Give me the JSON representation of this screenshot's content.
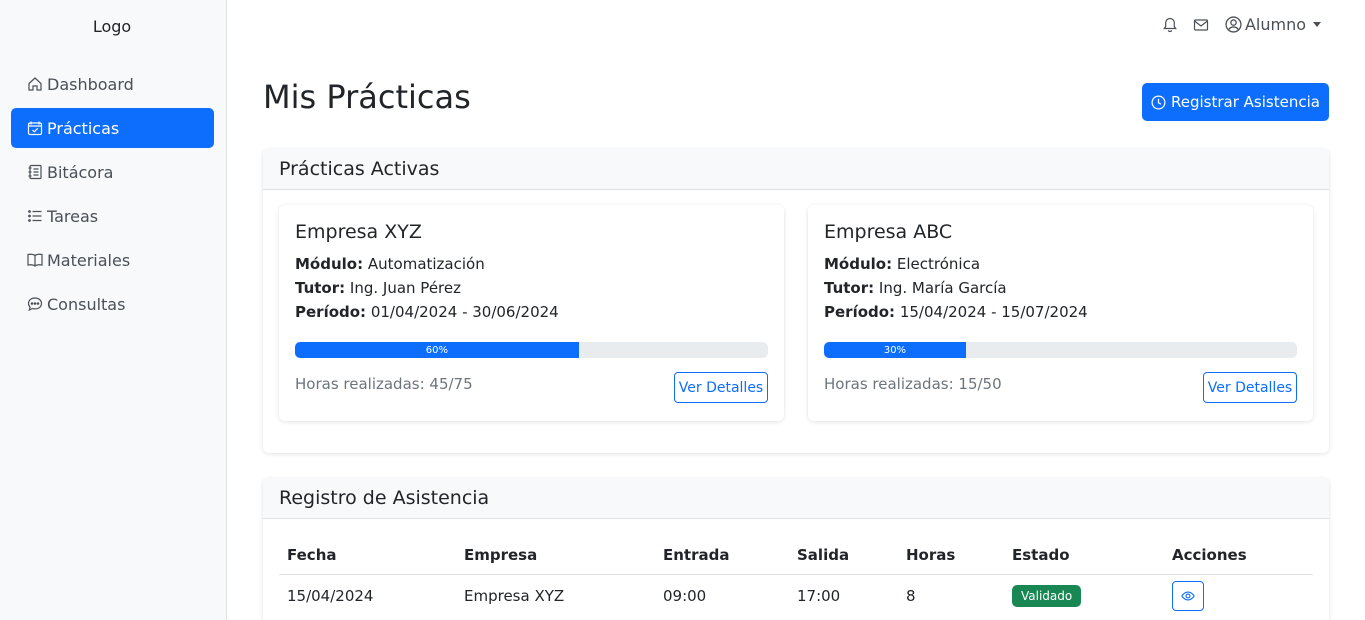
{
  "sidebar": {
    "logo": "Logo",
    "items": [
      {
        "label": "Dashboard",
        "icon": "home-icon"
      },
      {
        "label": "Prácticas",
        "icon": "calendar-check-icon",
        "active": true
      },
      {
        "label": "Bitácora",
        "icon": "journal-icon"
      },
      {
        "label": "Tareas",
        "icon": "list-task-icon"
      },
      {
        "label": "Materiales",
        "icon": "book-icon"
      },
      {
        "label": "Consultas",
        "icon": "chat-dots-icon"
      }
    ]
  },
  "topbar": {
    "user_label": "Alumno"
  },
  "page": {
    "title": "Mis Prácticas",
    "register_button": "Registrar Asistencia"
  },
  "active_practices": {
    "header": "Prácticas Activas",
    "modulo_label": "Módulo:",
    "tutor_label": "Tutor:",
    "periodo_label": "Período:",
    "details_button": "Ver Detalles",
    "items": [
      {
        "company": "Empresa XYZ",
        "modulo": "Automatización",
        "tutor": "Ing. Juan Pérez",
        "periodo": "01/04/2024 - 30/06/2024",
        "progress_label": "60%",
        "progress_fraction": 0.6,
        "hours": "Horas realizadas: 45/75"
      },
      {
        "company": "Empresa ABC",
        "modulo": "Electrónica",
        "tutor": "Ing. María García",
        "periodo": "15/04/2024 - 15/07/2024",
        "progress_label": "30%",
        "progress_fraction": 0.3,
        "hours": "Horas realizadas: 15/50"
      }
    ]
  },
  "attendance": {
    "header": "Registro de Asistencia",
    "columns": [
      "Fecha",
      "Empresa",
      "Entrada",
      "Salida",
      "Horas",
      "Estado",
      "Acciones"
    ],
    "rows": [
      {
        "fecha": "15/04/2024",
        "empresa": "Empresa XYZ",
        "entrada": "09:00",
        "salida": "17:00",
        "horas": "8",
        "estado": "Validado"
      }
    ]
  },
  "colors": {
    "primary": "#0d6efd",
    "success": "#198754",
    "sidebar_bg": "#f8f9fa"
  }
}
